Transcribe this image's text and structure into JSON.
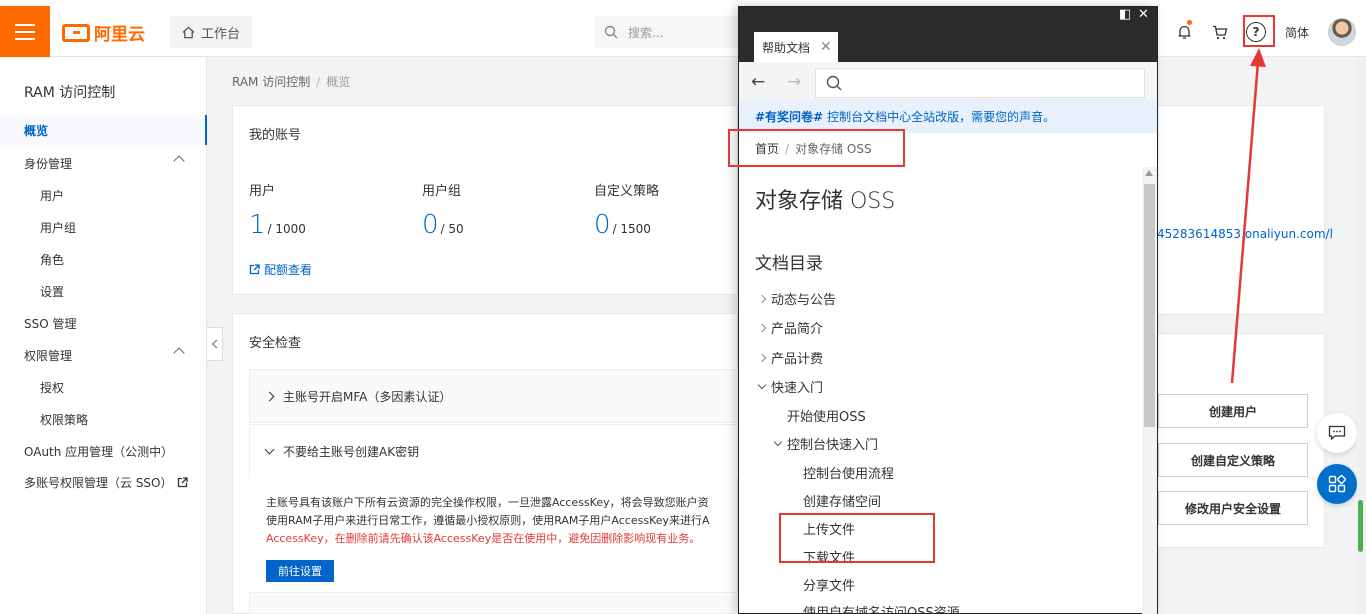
{
  "topbar": {
    "logo_text": "阿里云",
    "workbench_label": "工作台",
    "search_placeholder": "搜索...",
    "lang_label": "简体"
  },
  "sidebar": {
    "title": "RAM 访问控制",
    "items": [
      {
        "label": "概览",
        "active": true
      },
      {
        "label": "身份管理",
        "expanded": true
      },
      {
        "label": "用户",
        "sub": true
      },
      {
        "label": "用户组",
        "sub": true
      },
      {
        "label": "角色",
        "sub": true
      },
      {
        "label": "设置",
        "sub": true
      },
      {
        "label": "SSO 管理"
      },
      {
        "label": "权限管理",
        "expanded": true
      },
      {
        "label": "授权",
        "sub": true
      },
      {
        "label": "权限策略",
        "sub": true
      },
      {
        "label": "OAuth 应用管理（公测中）"
      },
      {
        "label": "多账号权限管理（云 SSO）"
      }
    ]
  },
  "breadcrumb": {
    "root": "RAM 访问控制",
    "current": "概览"
  },
  "account_card": {
    "title": "我的账号",
    "stats": [
      {
        "label": "用户",
        "value": "1",
        "limit": "/ 1000"
      },
      {
        "label": "用户组",
        "value": "0",
        "limit": "/ 50"
      },
      {
        "label": "自定义策略",
        "value": "0",
        "limit": "/ 1500"
      }
    ],
    "quota_link": "配额查看"
  },
  "security_card": {
    "title": "安全检查",
    "items": [
      {
        "label": "主账号开启MFA（多因素认证）",
        "expanded": false
      },
      {
        "label": "不要给主账号创建AK密钥",
        "expanded": true
      }
    ],
    "description": "主账号具有该账户下所有云资源的完全操作权限，一旦泄露AccessKey，将会导致您账户资",
    "description2": "使用RAM子用户来进行日常工作，遵循最小授权原则，使用RAM子用户AccessKey来进行A",
    "warning": "AccessKey，在删除前请先确认该AccessKey是否在使用中，避免因删除影响现有业务。",
    "go_button": "前往设置"
  },
  "right_panel": {
    "url_fragment": "45283614853.onaliyun.com/l",
    "actions": [
      "创建用户",
      "创建自定义策略",
      "修改用户安全设置"
    ]
  },
  "help_panel": {
    "tab_label": "帮助文档",
    "notice_tag": "#有奖问卷#",
    "notice_text": "控制台文档中心全站改版，需要您的声音。",
    "crumb_home": "首页",
    "crumb_current": "对象存储 OSS",
    "heading": "对象存储 OSS",
    "toc_title": "文档目录",
    "toc": [
      {
        "label": "动态与公告",
        "level": 0,
        "state": "collapsed"
      },
      {
        "label": "产品简介",
        "level": 0,
        "state": "collapsed"
      },
      {
        "label": "产品计费",
        "level": 0,
        "state": "collapsed"
      },
      {
        "label": "快速入门",
        "level": 0,
        "state": "expanded"
      },
      {
        "label": "开始使用OSS",
        "level": 1,
        "state": "leaf"
      },
      {
        "label": "控制台快速入门",
        "level": 1,
        "state": "expanded"
      },
      {
        "label": "控制台使用流程",
        "level": 2,
        "state": "leaf"
      },
      {
        "label": "创建存储空间",
        "level": 2,
        "state": "leaf"
      },
      {
        "label": "上传文件",
        "level": 2,
        "state": "leaf"
      },
      {
        "label": "下载文件",
        "level": 2,
        "state": "leaf"
      },
      {
        "label": "分享文件",
        "level": 2,
        "state": "leaf"
      },
      {
        "label": "使用自有域名访问OSS资源",
        "level": 2,
        "state": "leaf"
      }
    ]
  },
  "colors": {
    "brand": "#ff6a00",
    "link": "#0064c8",
    "annotation": "#e53935"
  }
}
